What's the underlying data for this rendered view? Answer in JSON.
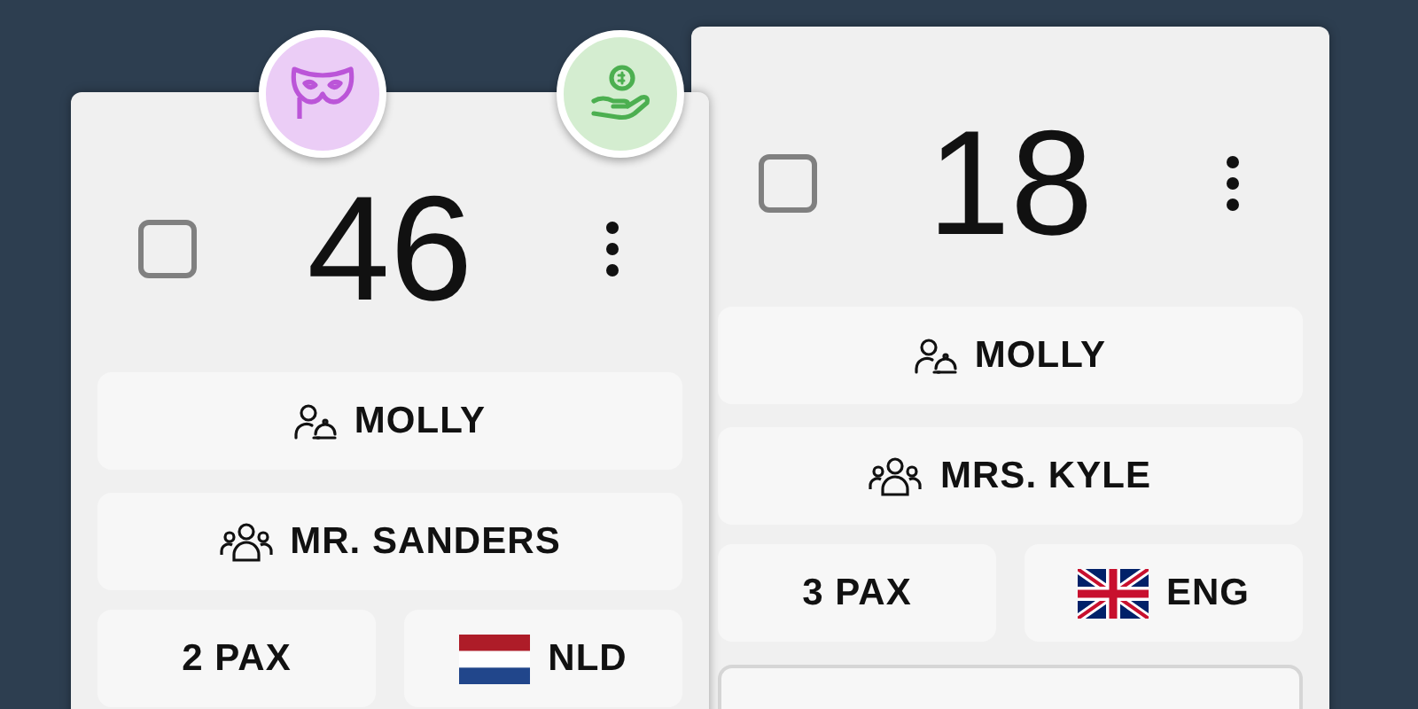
{
  "cards": [
    {
      "number": "46",
      "checked": false,
      "badges": [
        {
          "kind": "mask",
          "color": "#ebcdf6"
        },
        {
          "kind": "tip",
          "color": "#d4edd0"
        }
      ],
      "waiter": "MOLLY",
      "guest": "MR. SANDERS",
      "pax": "2 PAX",
      "language": {
        "kind": "nl",
        "code": "NLD"
      }
    },
    {
      "number": "18",
      "checked": false,
      "waiter": "MOLLY",
      "guest": "MRS. KYLE",
      "pax": "3 PAX",
      "language": {
        "kind": "gb",
        "code": "ENG"
      },
      "more_rows": true
    }
  ]
}
